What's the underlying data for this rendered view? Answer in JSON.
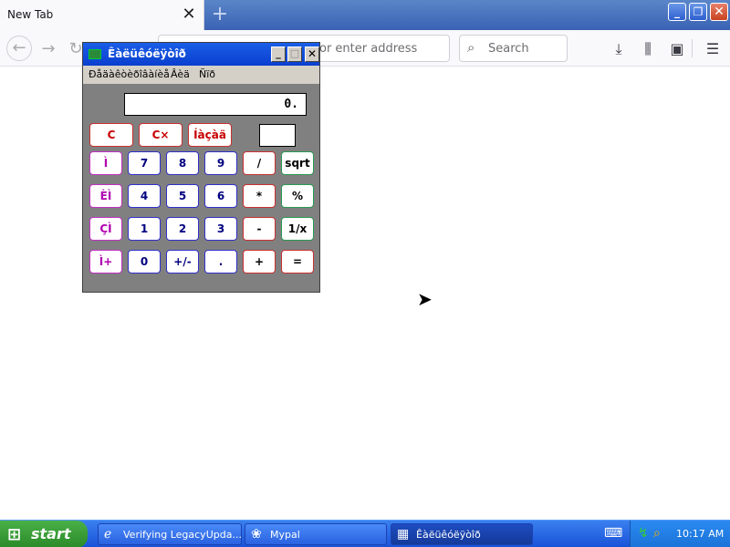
{
  "browser": {
    "tab_title": "New Tab",
    "tab_close": "✕",
    "new_tab": "+",
    "url_placeholder": "or enter address",
    "search_placeholder": "Search",
    "window_min": "_",
    "window_max": "❐",
    "window_close": "✕"
  },
  "calculator": {
    "title": "Êàëüêóëÿòîð",
    "menus": [
      "Ðåäàêòèðîâàíèå",
      "Âèä",
      "Ñïð"
    ],
    "display": "0.",
    "title_buttons": {
      "min": "_",
      "max": "□",
      "close": "✕"
    },
    "top_buttons": [
      "C",
      "C×",
      "Íàçàä"
    ],
    "memory_buttons": [
      "Ì",
      "ÈÌ",
      "ÇÌ",
      "Ì+"
    ],
    "digits": {
      "row1": [
        "7",
        "8",
        "9"
      ],
      "row2": [
        "4",
        "5",
        "6"
      ],
      "row3": [
        "1",
        "2",
        "3"
      ],
      "row4": [
        "0",
        "+/-",
        "."
      ]
    },
    "ops": [
      "/",
      "*",
      "-",
      "+"
    ],
    "funcs": [
      "sqrt",
      "%",
      "1/x",
      "="
    ]
  },
  "taskbar": {
    "start_label": "start",
    "tasks": [
      {
        "label": "Verifying LegacyUpda...",
        "icon": "ie-icon"
      },
      {
        "label": "Mypal",
        "icon": "mypal-icon"
      },
      {
        "label": "Êàëüêóëÿòîð",
        "icon": "calculator-icon"
      }
    ],
    "clock": "10:17 AM"
  }
}
